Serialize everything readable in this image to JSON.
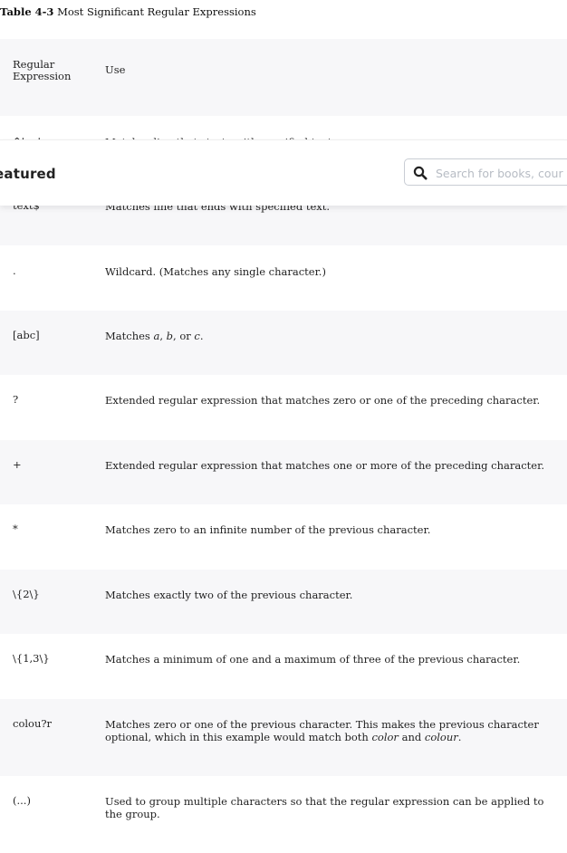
{
  "caption": {
    "number": "Table 4-3",
    "title": "Most Significant Regular Expressions"
  },
  "table": {
    "header": {
      "col1": "Regular Expression",
      "col2": "Use"
    },
    "rows": [
      {
        "expr": "^text",
        "use": "Matches line that starts with specified text."
      },
      {
        "expr": "text$",
        "use": "Matches line that ends with specified text."
      },
      {
        "expr": ".",
        "use": "Wildcard. (Matches any single character.)"
      },
      {
        "expr": "[abc]",
        "use_parts": [
          "Matches ",
          "a",
          ", ",
          "b",
          ", or ",
          "c",
          "."
        ]
      },
      {
        "expr": "?",
        "use": "Extended regular expression that matches zero or one of the preceding character."
      },
      {
        "expr": "+",
        "use": "Extended regular expression that matches one or more of the preceding character."
      },
      {
        "expr": "*",
        "use": "Matches zero to an infinite number of the previous character."
      },
      {
        "expr": "\\{2\\}",
        "use": "Matches exactly two of the previous character."
      },
      {
        "expr": "\\{1,3\\}",
        "use": "Matches a minimum of one and a maximum of three of the previous character."
      },
      {
        "expr": "colou?r",
        "use_parts": [
          "Matches zero or one of the previous character. This makes the previous character optional, which in this example would match both ",
          "color",
          " and ",
          "colour",
          "."
        ]
      },
      {
        "expr": "(...)",
        "use": "Used to group multiple characters so that the regular expression can be applied to the group."
      }
    ]
  },
  "topbar": {
    "brand": "eatured",
    "search_placeholder": "Search for books, cour"
  }
}
